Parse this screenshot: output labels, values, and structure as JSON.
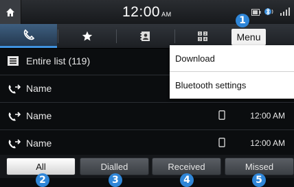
{
  "status_bar": {
    "time": "12:00",
    "ampm": "AM"
  },
  "tabs": [
    {
      "icon": "phone-handset-icon"
    },
    {
      "icon": "star-icon"
    },
    {
      "icon": "contacts-book-icon"
    },
    {
      "icon": "dial-keypad-icon"
    }
  ],
  "menu_button": "Menu",
  "list": {
    "header": "Entire list (119)",
    "rows": [
      {
        "name": "Name",
        "time": ""
      },
      {
        "name": "Name",
        "time": "12:00 AM"
      },
      {
        "name": "Name",
        "time": "12:00 AM"
      }
    ]
  },
  "dropdown": {
    "items": [
      "Download",
      "Bluetooth settings"
    ]
  },
  "filters": [
    {
      "label": "All",
      "active": true
    },
    {
      "label": "Dialled",
      "active": false
    },
    {
      "label": "Received",
      "active": false
    },
    {
      "label": "Missed",
      "active": false
    }
  ],
  "callouts": [
    "1",
    "2",
    "3",
    "4",
    "5"
  ],
  "colors": {
    "accent": "#3f93e0",
    "callout": "#2f86d8",
    "background": "#0b0d0f"
  }
}
